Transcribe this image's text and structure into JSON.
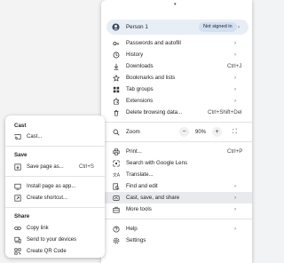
{
  "menu": {
    "profile": {
      "name": "Person 1",
      "status": "Not signed in"
    },
    "items": [
      {
        "label": "Passwords and autofill",
        "shortcut": "",
        "arrow": true
      },
      {
        "label": "History",
        "shortcut": "",
        "arrow": true
      },
      {
        "label": "Downloads",
        "shortcut": "Ctrl+J",
        "arrow": false
      },
      {
        "label": "Bookmarks and lists",
        "shortcut": "",
        "arrow": true
      },
      {
        "label": "Tab groups",
        "shortcut": "",
        "arrow": true
      },
      {
        "label": "Extensions",
        "shortcut": "",
        "arrow": true
      },
      {
        "label": "Delete browsing data...",
        "shortcut": "Ctrl+Shift+Del",
        "arrow": false
      }
    ],
    "zoom": {
      "label": "Zoom",
      "minus": "−",
      "value": "90%",
      "plus": "+"
    },
    "items2": [
      {
        "label": "Print...",
        "shortcut": "Ctrl+P"
      },
      {
        "label": "Search with Google Lens",
        "shortcut": ""
      },
      {
        "label": "Translate...",
        "shortcut": ""
      },
      {
        "label": "Find and edit",
        "shortcut": ""
      },
      {
        "label": "Cast, save, and share",
        "shortcut": ""
      },
      {
        "label": "More tools",
        "shortcut": ""
      }
    ],
    "items3": [
      {
        "label": "Help"
      },
      {
        "label": "Settings"
      }
    ]
  },
  "submenu": {
    "cast_heading": "Cast",
    "cast_item": "Cast...",
    "save_heading": "Save",
    "save_page": "Save page as...",
    "save_page_shortcut": "Ctrl+S",
    "install_page": "Install page as app...",
    "create_shortcut": "Create shortcut...",
    "share_heading": "Share",
    "copy_link": "Copy link",
    "send_devices": "Send to your devices",
    "create_qr": "Create QR Code"
  }
}
